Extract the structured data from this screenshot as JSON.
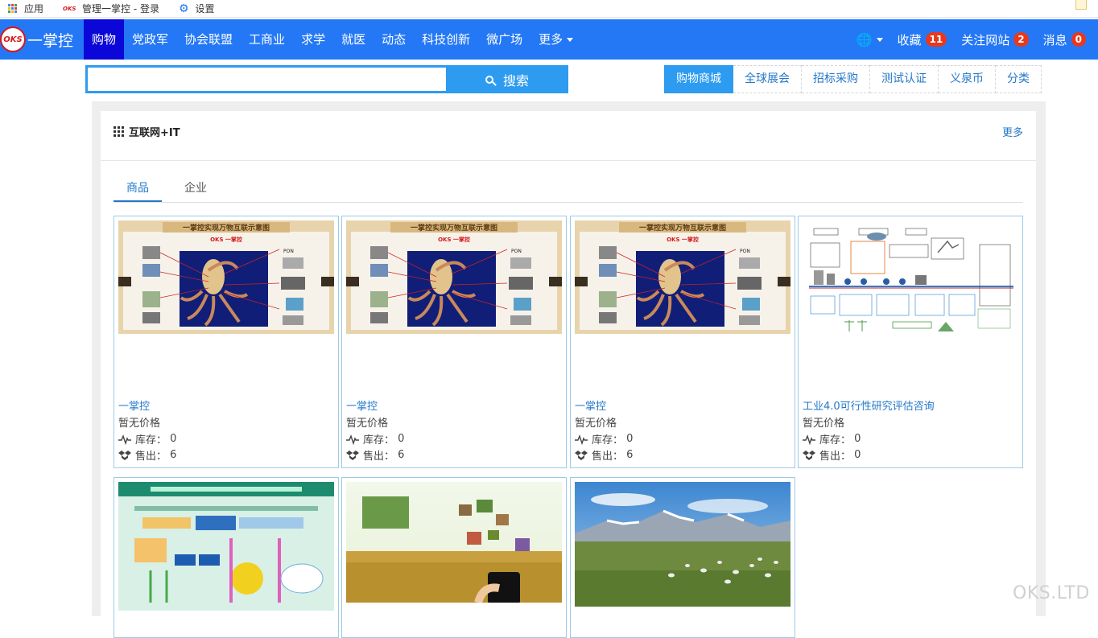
{
  "bookmarks": {
    "apps": "应用",
    "login": "管理一掌控 - 登录",
    "settings": "设置"
  },
  "brand": {
    "logo_mark": "OKS",
    "name": "一掌控",
    "color": "#2478f6"
  },
  "nav": {
    "items": [
      "购物",
      "党政军",
      "协会联盟",
      "工商业",
      "求学",
      "就医",
      "动态",
      "科技创新",
      "微广场",
      "更多"
    ],
    "right": {
      "favorites": "收藏",
      "favorites_count": "11",
      "follow": "关注网站",
      "follow_count": "2",
      "messages": "消息",
      "messages_count": "0"
    }
  },
  "search": {
    "value": "",
    "placeholder": "",
    "button": "搜索"
  },
  "channels": [
    "购物商城",
    "全球展会",
    "招标采购",
    "测试认证",
    "义泉币",
    "分类"
  ],
  "section": {
    "title": "互联网+IT",
    "more": "更多",
    "tabs": [
      "商品",
      "企业"
    ],
    "stock_label": "库存：",
    "sold_label": "售出：",
    "products": [
      {
        "name": "一掌控",
        "price": "暂无价格",
        "stock": "0",
        "sold": "6",
        "image_caption": "一掌控实现万物互联示意图",
        "image_logo": "OKS 一掌控",
        "image_label": "PON"
      },
      {
        "name": "一掌控",
        "price": "暂无价格",
        "stock": "0",
        "sold": "6",
        "image_caption": "一掌控实现万物互联示意图",
        "image_logo": "OKS 一掌控",
        "image_label": "PON"
      },
      {
        "name": "一掌控",
        "price": "暂无价格",
        "stock": "0",
        "sold": "6",
        "image_caption": "一掌控实现万物互联示意图",
        "image_logo": "OKS 一掌控",
        "image_label": "PON"
      },
      {
        "name": "工业4.0可行性研究评估咨询",
        "price": "暂无价格",
        "stock": "0",
        "sold": "0"
      }
    ]
  },
  "watermark": "OKS.LTD"
}
